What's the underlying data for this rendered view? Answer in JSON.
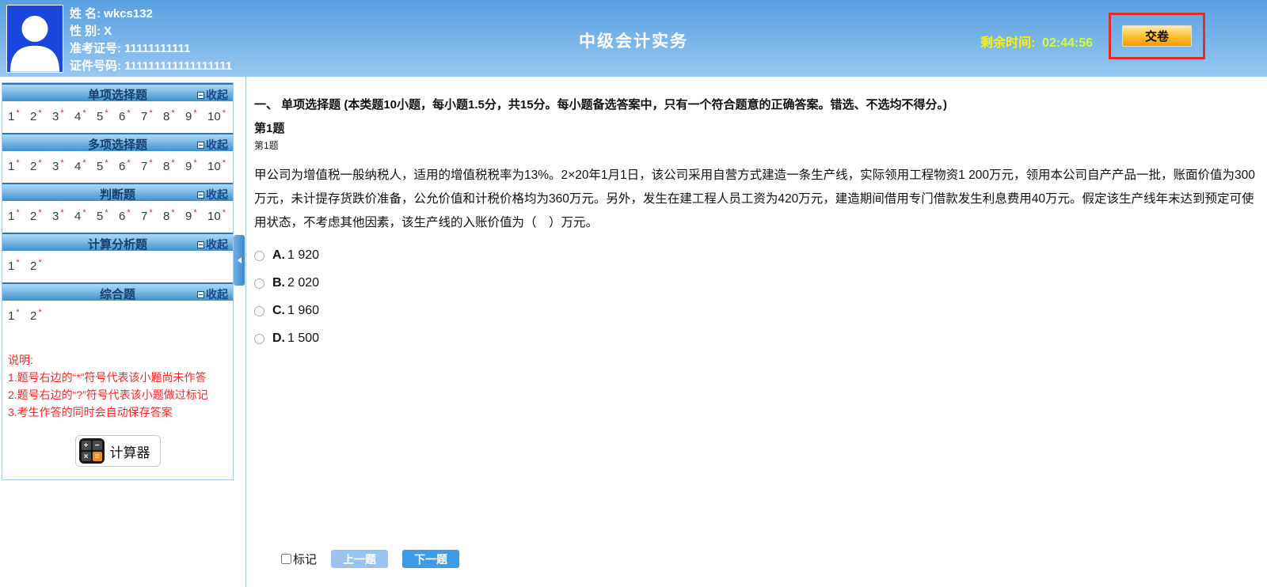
{
  "header": {
    "title": "中级会计实务",
    "user": {
      "rows": [
        {
          "label": "姓 名:",
          "value": "wkcs132"
        },
        {
          "label": "性 别:",
          "value": "X"
        },
        {
          "label": "准考证号:",
          "value": "11111111111"
        },
        {
          "label": "证件号码:",
          "value": "111111111111111111"
        }
      ]
    },
    "timer_label": "剩余时间:",
    "timer_value": "02:44:56",
    "submit_label": "交卷"
  },
  "sidebar": {
    "collapse_label": "收起",
    "unanswered_marker": "*",
    "sections": [
      {
        "title": "单项选择题",
        "questions": [
          "1",
          "2",
          "3",
          "4",
          "5",
          "6",
          "7",
          "8",
          "9",
          "10"
        ]
      },
      {
        "title": "多项选择题",
        "questions": [
          "1",
          "2",
          "3",
          "4",
          "5",
          "6",
          "7",
          "8",
          "9",
          "10"
        ]
      },
      {
        "title": "判断题",
        "questions": [
          "1",
          "2",
          "3",
          "4",
          "5",
          "6",
          "7",
          "8",
          "9",
          "10"
        ]
      },
      {
        "title": "计算分析题",
        "questions": [
          "1",
          "2"
        ]
      },
      {
        "title": "综合题",
        "questions": [
          "1",
          "2"
        ]
      }
    ],
    "notes_title": "说明:",
    "notes": [
      "1.题号右边的“*”符号代表该小题尚未作答",
      "2.题号右边的“?”符号代表该小题做过标记",
      "3.考生作答的同时会自动保存答案"
    ],
    "calculator_label": "计算器",
    "calc_keys": {
      "plus": "+",
      "minus": "−",
      "times": "×",
      "equals": "="
    }
  },
  "main": {
    "section_heading": "一、 单项选择题 (本类题10小题，每小题1.5分，共15分。每小题备选答案中，只有一个符合题意的正确答案。错选、不选均不得分。)",
    "question_no": "第1题",
    "question_no_small": "第1题",
    "question_text": "甲公司为增值税一般纳税人，适用的增值税税率为13%。2×20年1月1日，该公司采用自营方式建造一条生产线，实际领用工程物资1 200万元，领用本公司自产产品一批，账面价值为300万元，未计提存货跌价准备，公允价值和计税价格均为360万元。另外，发生在建工程人员工资为420万元，建造期间借用专门借款发生利息费用40万元。假定该生产线年末达到预定可使用状态，不考虑其他因素，该生产线的入账价值为（　）万元。",
    "options": [
      {
        "letter": "A.",
        "text": "1 920"
      },
      {
        "letter": "B.",
        "text": "2 020"
      },
      {
        "letter": "C.",
        "text": "1 960"
      },
      {
        "letter": "D.",
        "text": "1 500"
      }
    ],
    "mark_label": "标记",
    "prev_label": "上一题",
    "next_label": "下一题"
  },
  "colors": {
    "header_top": "#58a0e2",
    "header_bottom": "#96c8f2",
    "section_header_blue": "#3e90cc",
    "panel_border": "#a6c8ee",
    "timer_label": "#fff000",
    "timer_value": "#ccff33",
    "submit_orange": "#f59b00",
    "highlight_red": "#e02d2d",
    "note_red": "#ff2222",
    "star_red": "#e02020",
    "prev_button": "#9ac4ef",
    "next_button": "#3e9be8"
  }
}
